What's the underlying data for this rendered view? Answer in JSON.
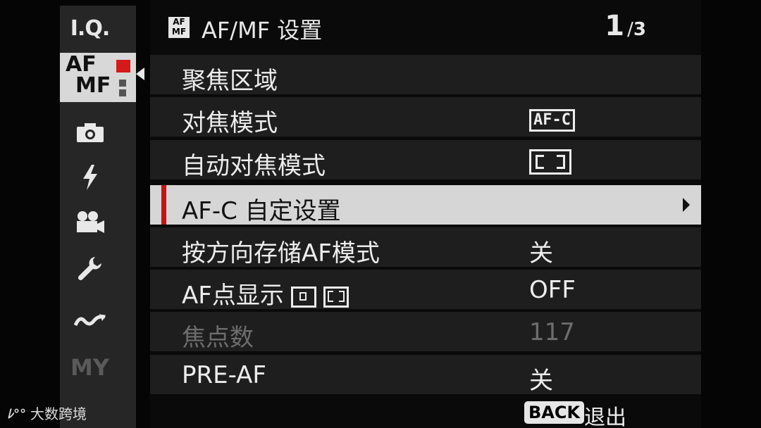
{
  "sidebar": {
    "items": [
      {
        "label": "I.Q."
      },
      {
        "label_top": "AF",
        "label_bottom": "MF"
      },
      {
        "icon": "camera-icon"
      },
      {
        "icon": "flash-icon"
      },
      {
        "icon": "movie-icon"
      },
      {
        "icon": "wrench-icon"
      },
      {
        "icon": "connection-icon"
      },
      {
        "label": "MY"
      }
    ]
  },
  "header": {
    "badge_top": "AF",
    "badge_bottom": "MF",
    "title": "AF/MF 设置",
    "page_current": "1",
    "page_separator": "/",
    "page_total": "3"
  },
  "menu": {
    "items": [
      {
        "label": "聚焦区域",
        "value": ""
      },
      {
        "label": "对焦模式",
        "value": "AF-C"
      },
      {
        "label": "自动对焦模式",
        "value": ""
      },
      {
        "label": "AF-C 自定设置",
        "value": ""
      },
      {
        "label": "按方向存储AF模式",
        "value": "关"
      },
      {
        "label": "AF点显示",
        "value": "OFF"
      },
      {
        "label": "焦点数",
        "value": "117"
      },
      {
        "label": "PRE-AF",
        "value": "关"
      }
    ]
  },
  "footer": {
    "back_key": "BACK",
    "back_label": "退出"
  },
  "watermark": {
    "logo": "ﾚ°°",
    "text": "大数跨境"
  },
  "colors": {
    "selected_bar": "#c41414",
    "selected_row_bg": "#d6d6d6",
    "row_bg": "#1e1e1e",
    "active_tab_accent": "#d41a1a"
  }
}
